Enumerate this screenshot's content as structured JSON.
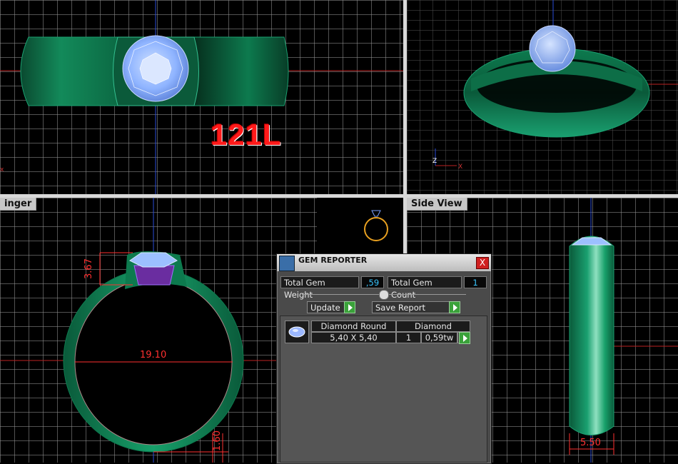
{
  "viewports": {
    "top_left": {
      "label": "",
      "watermark": "121L"
    },
    "top_right": {
      "label": ""
    },
    "bottom_left": {
      "label": "inger",
      "dims": {
        "width": "19.10",
        "height": "3.67",
        "bottom": "1.60"
      }
    },
    "bottom_right": {
      "label": "Side View",
      "dims": {
        "width": "5.50"
      }
    }
  },
  "axes_labels": {
    "x": "X",
    "z": "Z"
  },
  "gem_reporter": {
    "title": "GEM REPORTER",
    "close_label": "X",
    "total_weight_label": "Total Gem Weight",
    "total_weight_value": ",59",
    "total_count_label": "Total Gem Count",
    "total_count_value": "1",
    "update_label": "Update",
    "save_report_label": "Save Report",
    "gems": [
      {
        "shape": "Diamond Round",
        "size": "5,40 X 5,40",
        "material": "Diamond",
        "count": "1",
        "weight": "0,59tw"
      }
    ]
  },
  "colors": {
    "metal": "#0f7a4f",
    "gem": "#8fb4ff",
    "accent_red": "#ff1a1a",
    "value_cyan": "#39c6ff"
  }
}
